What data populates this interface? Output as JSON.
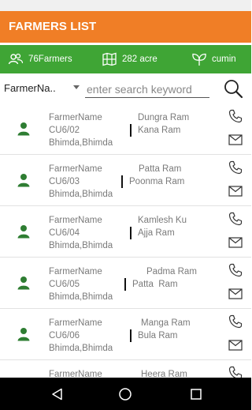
{
  "header": {
    "title": "FARMERS LIST"
  },
  "stats": {
    "farmers": "76Farmers",
    "area": "282 acre",
    "crop": "cumin"
  },
  "search": {
    "field_value": "FarmerNa..",
    "placeholder": "enter search keyword"
  },
  "farmers": [
    {
      "label": "FarmerName",
      "code": "CU6/02",
      "location": "Bhimda,Bhimda",
      "name": "Dungra Ram",
      "father": "Kana Ram"
    },
    {
      "label": "FarmerName",
      "code": "CU6/03",
      "location": "Bhimda,Bhimda",
      "name": "Patta Ram",
      "father": "Poonma Ram"
    },
    {
      "label": "FarmerName",
      "code": "CU6/04",
      "location": "Bhimda,Bhimda",
      "name": "Kamlesh Ku",
      "father": "Ajja Ram"
    },
    {
      "label": "FarmerName",
      "code": "CU6/05",
      "location": "Bhimda,Bhimda",
      "name": "Padma Ram",
      "father": "Patta  Ram"
    },
    {
      "label": "FarmerName",
      "code": "CU6/06",
      "location": "Bhimda,Bhimda",
      "name": "Manga Ram",
      "father": "Bula Ram"
    },
    {
      "label": "FarmerName",
      "code": "",
      "location": "",
      "name": "Heera Ram",
      "father": ""
    }
  ],
  "colors": {
    "appbar": "#f07e26",
    "statsbar": "#3fa535",
    "avatar": "#2e7d32"
  },
  "icons": {
    "stats": [
      "farmers-group-icon",
      "field-map-icon",
      "crop-leaf-icon"
    ],
    "row": [
      "farmer-avatar-icon",
      "phone-icon",
      "mail-icon"
    ],
    "nav": [
      "back-icon",
      "home-icon",
      "recents-icon"
    ]
  }
}
